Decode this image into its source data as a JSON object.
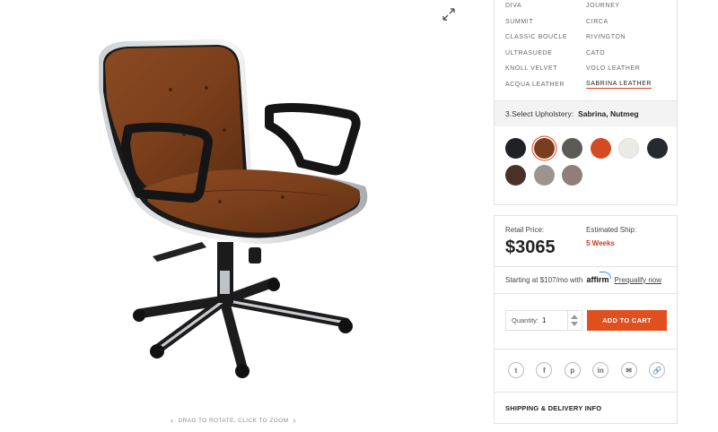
{
  "viewer": {
    "expand_icon": "expand-icon",
    "rotate_hint": "DRAG TO ROTATE, CLICK TO ZOOM",
    "prev_arrow": "‹",
    "next_arrow": "›"
  },
  "materials": {
    "left": [
      "DIVA",
      "SUMMIT",
      "CLASSIC BOUCLE",
      "ULTRASUEDE",
      "KNOLL VELVET",
      "ACQUA LEATHER"
    ],
    "right": [
      "JOURNEY",
      "CIRCA",
      "RIVINGTON",
      "CATO",
      "VOLO LEATHER",
      "SABRINA LEATHER"
    ],
    "selected": "SABRINA LEATHER"
  },
  "upholstery": {
    "label": "3.Select Upholstery:",
    "value": "Sabrina, Nutmeg",
    "swatches": [
      {
        "name": "black",
        "color": "#1f2124"
      },
      {
        "name": "nutmeg",
        "color": "#7a3e1e",
        "selected": true
      },
      {
        "name": "graphite",
        "color": "#5c5a57"
      },
      {
        "name": "orange",
        "color": "#d24b22"
      },
      {
        "name": "white",
        "color": "#ebebe6"
      },
      {
        "name": "navy-black",
        "color": "#262a30"
      },
      {
        "name": "chocolate",
        "color": "#4a3128"
      },
      {
        "name": "taupe",
        "color": "#9c948f"
      },
      {
        "name": "mushroom",
        "color": "#8f7f78"
      }
    ]
  },
  "pricing": {
    "retail_label": "Retail Price:",
    "price": "$3065",
    "ship_label": "Estimated Ship:",
    "ship_value": "5 Weeks",
    "affirm_prefix": "Starting at $107/mo with",
    "affirm_brand": "affirm",
    "prequalify": "Prequalify now"
  },
  "cart": {
    "qty_label": "Quantity:",
    "qty_value": "1",
    "add_label": "ADD TO CART"
  },
  "share": [
    {
      "icon": "twitter-icon",
      "glyph": "t"
    },
    {
      "icon": "facebook-icon",
      "glyph": "f"
    },
    {
      "icon": "pinterest-icon",
      "glyph": "p"
    },
    {
      "icon": "linkedin-icon",
      "glyph": "in"
    },
    {
      "icon": "email-icon",
      "glyph": "✉"
    },
    {
      "icon": "link-icon",
      "glyph": "🔗"
    }
  ],
  "shipping_link": "SHIPPING & DELIVERY INFO"
}
